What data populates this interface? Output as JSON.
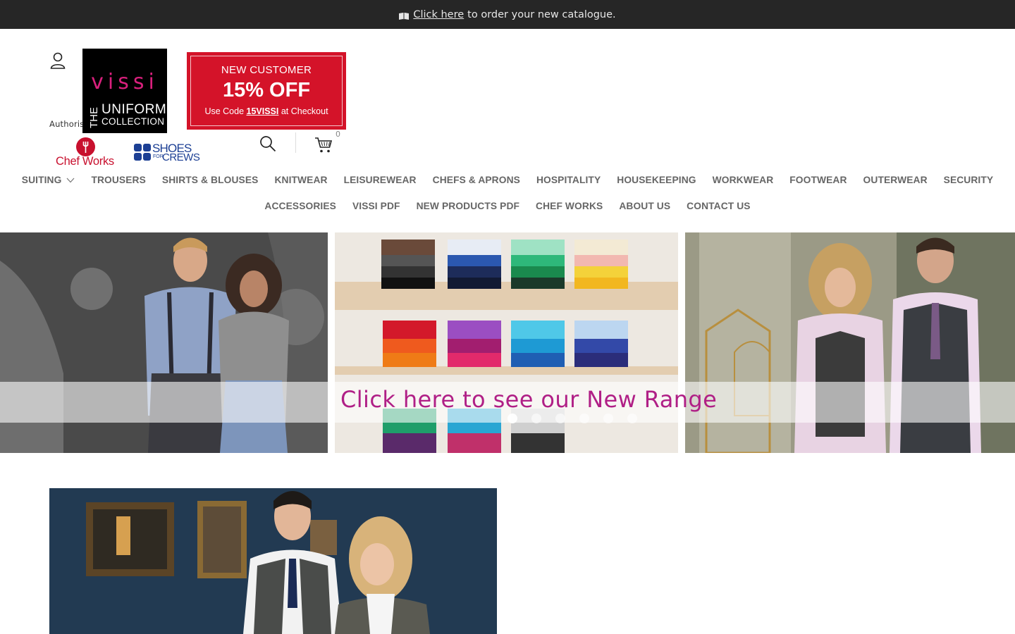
{
  "topbar": {
    "link_text": "Click here",
    "rest_text": "to order your new catalogue."
  },
  "header": {
    "authorised_text": "Authoris",
    "logo": {
      "brand": "vissi",
      "the": "THE",
      "uniform": "UNIFORM",
      "collection": "COLLECTION"
    },
    "promo": {
      "line1": "NEW CUSTOMER",
      "line2": "15% OFF",
      "line3_prefix": "Use Code ",
      "code": "15VISSI",
      "line3_suffix": " at Checkout"
    },
    "cart_count": "0",
    "partners": {
      "chefworks": "Chef Works",
      "sfc_line1": "SHOES",
      "sfc_small": "FOR",
      "sfc_line2": "CREWS"
    }
  },
  "nav": {
    "row1": [
      "SUITING",
      "TROUSERS",
      "SHIRTS & BLOUSES",
      "KNITWEAR",
      "LEISUREWEAR",
      "CHEFS & APRONS",
      "HOSPITALITY",
      "HOUSEKEEPING",
      "WORKWEAR",
      "FOOTWEAR",
      "OUTERWEAR",
      "SECURITY"
    ],
    "row2": [
      "ACCESSORIES",
      "VISSI PDF",
      "NEW PRODUCTS PDF",
      "CHEF WORKS",
      "ABOUT US",
      "CONTACT US"
    ]
  },
  "hero": {
    "caption": "Click here to see our New Range",
    "slide_count": 6,
    "active_slide": 1
  },
  "colors": {
    "topbar_bg": "#262626",
    "promo_red": "#d41329",
    "brand_magenta": "#d9207d",
    "hero_caption": "#b01f86",
    "nav_text": "#666666"
  }
}
